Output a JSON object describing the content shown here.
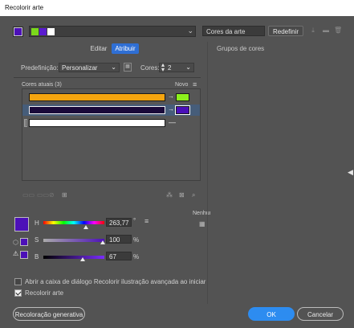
{
  "window": {
    "title": "Recolorir arte"
  },
  "toolbar": {
    "harmony_colors": [
      "#7bd81c",
      "#5a1ccf",
      "#ffffff"
    ],
    "group_name": "Cores da arte",
    "reset_label": "Redefinir"
  },
  "tabs": {
    "edit": "Editar",
    "assign": "Atribuir"
  },
  "preset": {
    "label": "Predefinição:",
    "value": "Personalizar"
  },
  "colors_count": {
    "label": "Cores:",
    "value": "2"
  },
  "table": {
    "header_left": "Cores atuais (3)",
    "header_right": "Novo",
    "rows": [
      {
        "current": "#f5a50f",
        "new": "#8cf01c",
        "selected": false
      },
      {
        "current": "#1a0a3a",
        "new": "#4a10b8",
        "selected": true
      },
      {
        "current": "#ffffff",
        "new": "",
        "selected": false
      }
    ]
  },
  "mode": {
    "label": "Nenhum"
  },
  "color": {
    "swatch": "#4c10b8",
    "h": {
      "label": "H",
      "value": "263,77",
      "unit": "°"
    },
    "s": {
      "label": "S",
      "value": "100",
      "unit": "%"
    },
    "b": {
      "label": "B",
      "value": "67",
      "unit": "%"
    }
  },
  "options": {
    "advanced_dialog": {
      "label": "Abrir a caixa de diálogo Recolorir ilustração avançada ao iniciar",
      "checked": false
    },
    "recolor_art": {
      "label": "Recolorir arte",
      "checked": true
    }
  },
  "groups": {
    "title": "Grupos de cores"
  },
  "buttons": {
    "generative": "Recoloração generativa",
    "ok": "OK",
    "cancel": "Cancelar"
  }
}
